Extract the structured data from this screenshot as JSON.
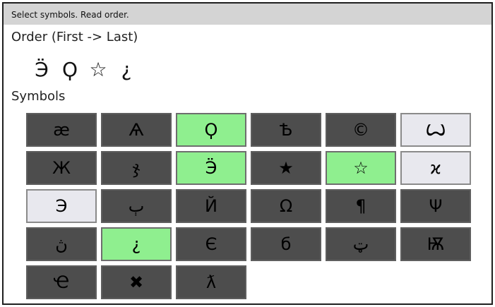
{
  "window": {
    "title": "Select symbols. Read order."
  },
  "order": {
    "heading": "Order (First -> Last)",
    "symbols": [
      "Ӭ",
      "Ϙ",
      "☆",
      "¿"
    ]
  },
  "symbols_section": {
    "heading": "Symbols"
  },
  "tiles": [
    {
      "symbol": "æ",
      "state": "dark"
    },
    {
      "symbol": "Ѧ",
      "state": "dark"
    },
    {
      "symbol": "Ϙ",
      "state": "selected"
    },
    {
      "symbol": "Ѣ",
      "state": "dark"
    },
    {
      "symbol": "©",
      "state": "dark"
    },
    {
      "symbol": "Ꙍ",
      "state": "light"
    },
    {
      "symbol": "Ж",
      "state": "dark"
    },
    {
      "symbol": "ჯ",
      "state": "dark"
    },
    {
      "symbol": "Ӭ",
      "state": "selected"
    },
    {
      "symbol": "★",
      "state": "dark"
    },
    {
      "symbol": "☆",
      "state": "selected"
    },
    {
      "symbol": "ϰ",
      "state": "light"
    },
    {
      "symbol": "Э",
      "state": "light"
    },
    {
      "symbol": "ٻ",
      "state": "dark"
    },
    {
      "symbol": "Й",
      "state": "dark"
    },
    {
      "symbol": "Ω",
      "state": "dark"
    },
    {
      "symbol": "¶",
      "state": "dark"
    },
    {
      "symbol": "Ψ",
      "state": "dark"
    },
    {
      "symbol": "ڽ",
      "state": "dark"
    },
    {
      "symbol": "¿",
      "state": "selected"
    },
    {
      "symbol": "Є",
      "state": "dark"
    },
    {
      "symbol": "б",
      "state": "dark"
    },
    {
      "symbol": "ټ",
      "state": "dark"
    },
    {
      "symbol": "Ѭ",
      "state": "dark"
    },
    {
      "symbol": "Ҽ",
      "state": "dark"
    },
    {
      "symbol": "✖",
      "state": "dark"
    },
    {
      "symbol": "ƛ",
      "state": "dark"
    }
  ]
}
